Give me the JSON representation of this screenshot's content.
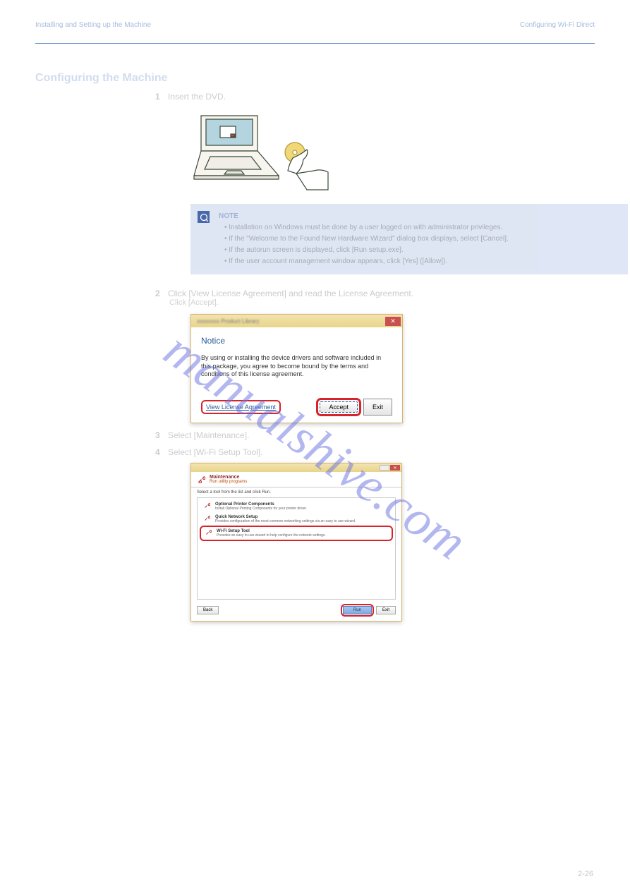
{
  "header": {
    "left": "Installing and Setting up the Machine",
    "right": "Configuring Wi-Fi Direct"
  },
  "section_title": "Configuring the Machine",
  "steps": {
    "s1": {
      "num": "1",
      "text": "Insert the DVD."
    },
    "note": {
      "title": "NOTE",
      "bullets": [
        "Installation on Windows must be done by a user logged on with administrator privileges.",
        "If the \"Welcome to the Found New Hardware Wizard\" dialog box displays, select [Cancel].",
        "If the autorun screen is displayed, click [Run setup.exe].",
        "If the user account management window appears, click [Yes] ([Allow])."
      ]
    },
    "s2": {
      "num": "2",
      "text": "Click [View License Agreement] and read the License Agreement."
    },
    "s2b": "Click [Accept].",
    "s3": {
      "num": "3",
      "text": "Select [Maintenance]."
    },
    "s4": {
      "num": "4",
      "text": "Select [Wi-Fi Setup Tool]."
    }
  },
  "notice_dialog": {
    "heading": "Notice",
    "text": "By using or installing the device drivers and software included in this package, you agree to become bound by the terms and conditions of this license agreement.",
    "view_link": "View License Agreement",
    "accept": "Accept",
    "exit": "Exit"
  },
  "maint_dialog": {
    "header_title": "Maintenance",
    "header_sub": "Run utility programs",
    "desc": "Select a tool from the list and click Run.",
    "items": [
      {
        "title": "Optional Printer Components",
        "desc": "Install Optional Printing Components for your printer driver."
      },
      {
        "title": "Quick Network Setup",
        "desc": "Provides configuration of the most common networking settings via an easy to use wizard."
      },
      {
        "title": "Wi-Fi Setup Tool",
        "desc": "Provides an easy to use wizard to help configure the network settings."
      }
    ],
    "back": "Back",
    "next": "Run",
    "exit": "Exit"
  },
  "watermark": "manualshive.com",
  "page_num": "2-26"
}
